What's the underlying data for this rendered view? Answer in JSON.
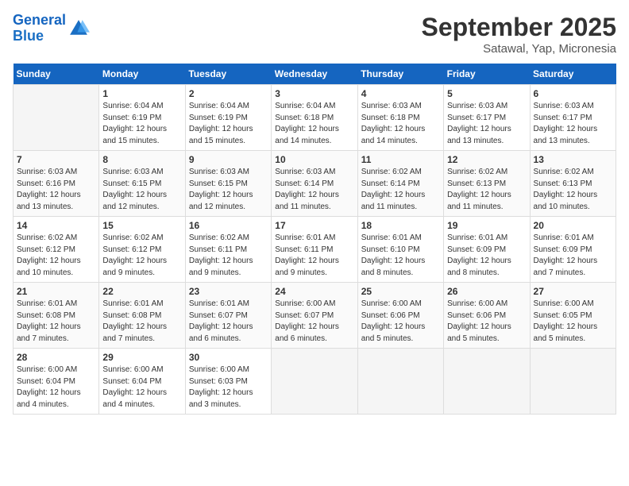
{
  "logo": {
    "line1": "General",
    "line2": "Blue"
  },
  "title": "September 2025",
  "subtitle": "Satawal, Yap, Micronesia",
  "days_of_week": [
    "Sunday",
    "Monday",
    "Tuesday",
    "Wednesday",
    "Thursday",
    "Friday",
    "Saturday"
  ],
  "weeks": [
    [
      {
        "day": "",
        "info": ""
      },
      {
        "day": "1",
        "info": "Sunrise: 6:04 AM\nSunset: 6:19 PM\nDaylight: 12 hours\nand 15 minutes."
      },
      {
        "day": "2",
        "info": "Sunrise: 6:04 AM\nSunset: 6:19 PM\nDaylight: 12 hours\nand 15 minutes."
      },
      {
        "day": "3",
        "info": "Sunrise: 6:04 AM\nSunset: 6:18 PM\nDaylight: 12 hours\nand 14 minutes."
      },
      {
        "day": "4",
        "info": "Sunrise: 6:03 AM\nSunset: 6:18 PM\nDaylight: 12 hours\nand 14 minutes."
      },
      {
        "day": "5",
        "info": "Sunrise: 6:03 AM\nSunset: 6:17 PM\nDaylight: 12 hours\nand 13 minutes."
      },
      {
        "day": "6",
        "info": "Sunrise: 6:03 AM\nSunset: 6:17 PM\nDaylight: 12 hours\nand 13 minutes."
      }
    ],
    [
      {
        "day": "7",
        "info": "Sunrise: 6:03 AM\nSunset: 6:16 PM\nDaylight: 12 hours\nand 13 minutes."
      },
      {
        "day": "8",
        "info": "Sunrise: 6:03 AM\nSunset: 6:15 PM\nDaylight: 12 hours\nand 12 minutes."
      },
      {
        "day": "9",
        "info": "Sunrise: 6:03 AM\nSunset: 6:15 PM\nDaylight: 12 hours\nand 12 minutes."
      },
      {
        "day": "10",
        "info": "Sunrise: 6:03 AM\nSunset: 6:14 PM\nDaylight: 12 hours\nand 11 minutes."
      },
      {
        "day": "11",
        "info": "Sunrise: 6:02 AM\nSunset: 6:14 PM\nDaylight: 12 hours\nand 11 minutes."
      },
      {
        "day": "12",
        "info": "Sunrise: 6:02 AM\nSunset: 6:13 PM\nDaylight: 12 hours\nand 11 minutes."
      },
      {
        "day": "13",
        "info": "Sunrise: 6:02 AM\nSunset: 6:13 PM\nDaylight: 12 hours\nand 10 minutes."
      }
    ],
    [
      {
        "day": "14",
        "info": "Sunrise: 6:02 AM\nSunset: 6:12 PM\nDaylight: 12 hours\nand 10 minutes."
      },
      {
        "day": "15",
        "info": "Sunrise: 6:02 AM\nSunset: 6:12 PM\nDaylight: 12 hours\nand 9 minutes."
      },
      {
        "day": "16",
        "info": "Sunrise: 6:02 AM\nSunset: 6:11 PM\nDaylight: 12 hours\nand 9 minutes."
      },
      {
        "day": "17",
        "info": "Sunrise: 6:01 AM\nSunset: 6:11 PM\nDaylight: 12 hours\nand 9 minutes."
      },
      {
        "day": "18",
        "info": "Sunrise: 6:01 AM\nSunset: 6:10 PM\nDaylight: 12 hours\nand 8 minutes."
      },
      {
        "day": "19",
        "info": "Sunrise: 6:01 AM\nSunset: 6:09 PM\nDaylight: 12 hours\nand 8 minutes."
      },
      {
        "day": "20",
        "info": "Sunrise: 6:01 AM\nSunset: 6:09 PM\nDaylight: 12 hours\nand 7 minutes."
      }
    ],
    [
      {
        "day": "21",
        "info": "Sunrise: 6:01 AM\nSunset: 6:08 PM\nDaylight: 12 hours\nand 7 minutes."
      },
      {
        "day": "22",
        "info": "Sunrise: 6:01 AM\nSunset: 6:08 PM\nDaylight: 12 hours\nand 7 minutes."
      },
      {
        "day": "23",
        "info": "Sunrise: 6:01 AM\nSunset: 6:07 PM\nDaylight: 12 hours\nand 6 minutes."
      },
      {
        "day": "24",
        "info": "Sunrise: 6:00 AM\nSunset: 6:07 PM\nDaylight: 12 hours\nand 6 minutes."
      },
      {
        "day": "25",
        "info": "Sunrise: 6:00 AM\nSunset: 6:06 PM\nDaylight: 12 hours\nand 5 minutes."
      },
      {
        "day": "26",
        "info": "Sunrise: 6:00 AM\nSunset: 6:06 PM\nDaylight: 12 hours\nand 5 minutes."
      },
      {
        "day": "27",
        "info": "Sunrise: 6:00 AM\nSunset: 6:05 PM\nDaylight: 12 hours\nand 5 minutes."
      }
    ],
    [
      {
        "day": "28",
        "info": "Sunrise: 6:00 AM\nSunset: 6:04 PM\nDaylight: 12 hours\nand 4 minutes."
      },
      {
        "day": "29",
        "info": "Sunrise: 6:00 AM\nSunset: 6:04 PM\nDaylight: 12 hours\nand 4 minutes."
      },
      {
        "day": "30",
        "info": "Sunrise: 6:00 AM\nSunset: 6:03 PM\nDaylight: 12 hours\nand 3 minutes."
      },
      {
        "day": "",
        "info": ""
      },
      {
        "day": "",
        "info": ""
      },
      {
        "day": "",
        "info": ""
      },
      {
        "day": "",
        "info": ""
      }
    ]
  ]
}
